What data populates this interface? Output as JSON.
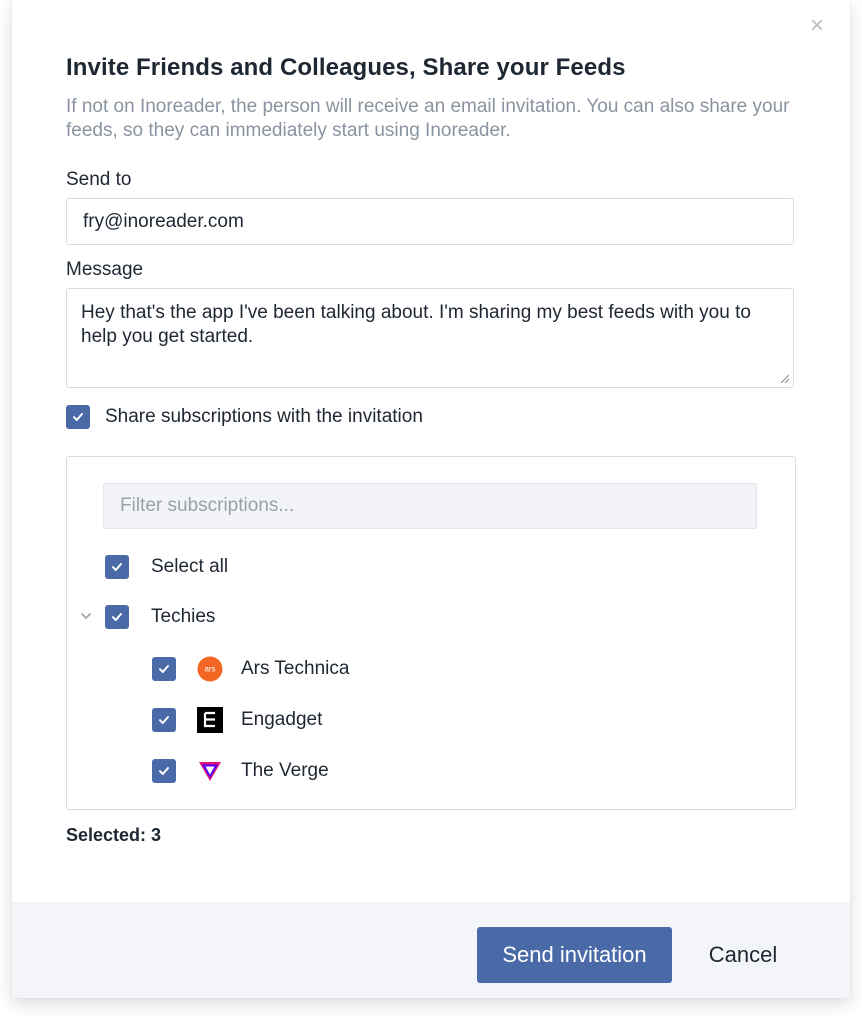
{
  "dialog": {
    "close_glyph": "×",
    "title": "Invite Friends and Colleagues, Share your Feeds",
    "subtitle": "If not on Inoreader, the person will receive an email invitation. You can also share your feeds, so they can immediately start using Inoreader."
  },
  "send_to": {
    "label": "Send to",
    "value": "fry@inoreader.com"
  },
  "message": {
    "label": "Message",
    "value": "Hey that's the app I've been talking about. I'm sharing my best feeds with you to help you get started."
  },
  "share_subscriptions": {
    "label": "Share subscriptions with the invitation",
    "checked": true
  },
  "subscriptions": {
    "filter_placeholder": "Filter subscriptions...",
    "select_all_label": "Select all",
    "folder": {
      "name": "Techies",
      "expanded": true,
      "feeds": [
        {
          "name": "Ars Technica",
          "icon": "ars-technica-icon",
          "icon_text": "ars",
          "color": "#f26522"
        },
        {
          "name": "Engadget",
          "icon": "engadget-icon",
          "color": "#000000"
        },
        {
          "name": "The Verge",
          "icon": "the-verge-icon",
          "color": "#5200ff"
        }
      ]
    }
  },
  "selected": {
    "text": "Selected: 3"
  },
  "footer": {
    "send_label": "Send invitation",
    "cancel_label": "Cancel"
  },
  "colors": {
    "accent": "#4a6aa7",
    "footer_bg": "#f3f5f8",
    "muted_text": "#8a93a0"
  }
}
